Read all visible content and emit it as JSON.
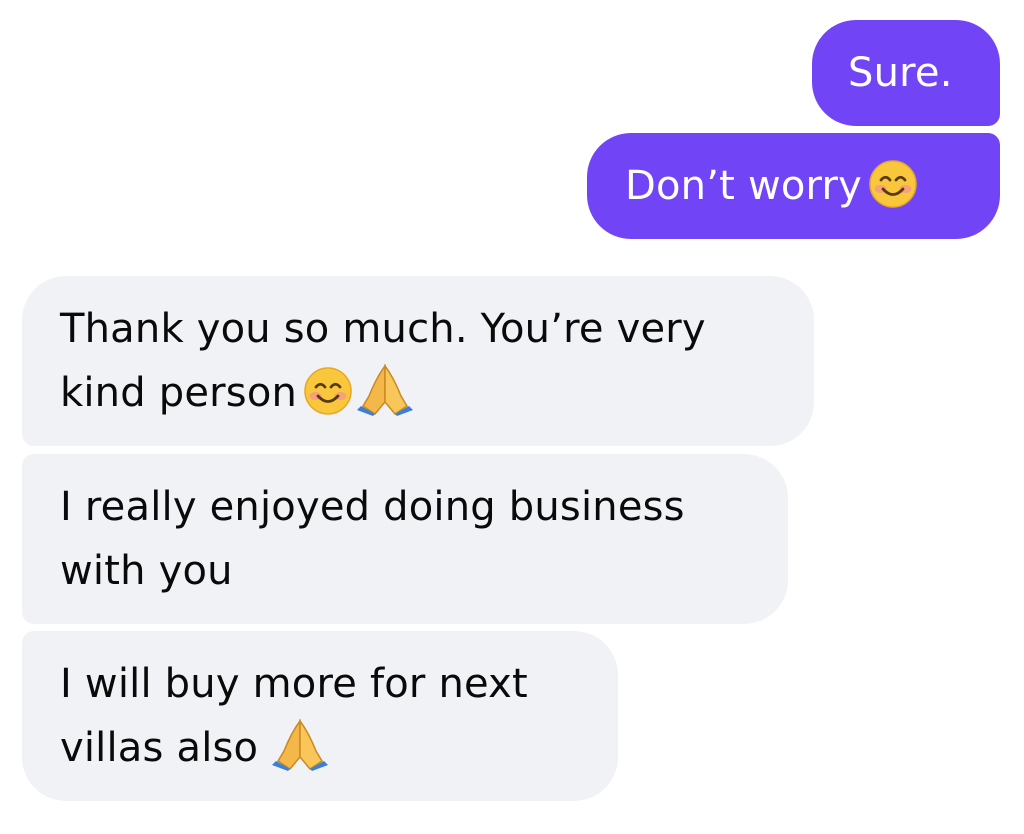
{
  "conversation": {
    "messages": [
      {
        "direction": "sent",
        "lines": [
          "Sure."
        ]
      },
      {
        "direction": "sent",
        "lines": [
          "Don’t worry"
        ],
        "emojis": [
          "smiling-face-emoji"
        ]
      },
      {
        "direction": "received",
        "lines": [
          "Thank you so much. You’re very",
          "kind person"
        ],
        "emojis": [
          "smiling-face-emoji",
          "folded-hands-emoji"
        ]
      },
      {
        "direction": "received",
        "lines": [
          "I really enjoyed doing business",
          "with you"
        ]
      },
      {
        "direction": "received",
        "lines": [
          "I will buy more for next",
          "villas also"
        ],
        "emojis": [
          "folded-hands-emoji"
        ]
      }
    ]
  },
  "colors": {
    "sent_bubble": "#7145f6",
    "received_bubble": "#f1f2f6",
    "sent_text": "#ffffff",
    "received_text": "#0a0a0a"
  }
}
